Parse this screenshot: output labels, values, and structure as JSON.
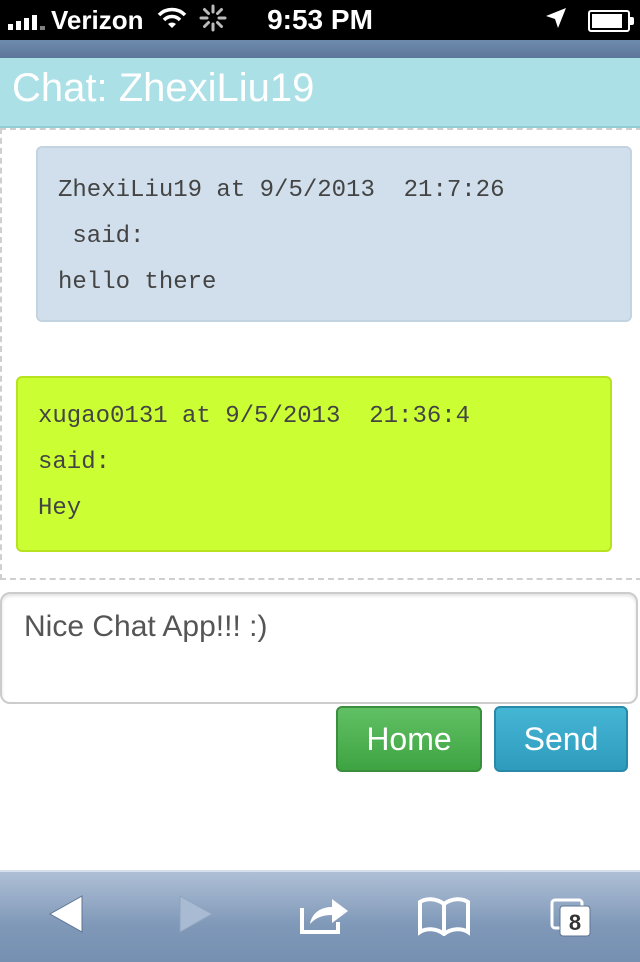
{
  "status_bar": {
    "carrier": "Verizon",
    "time": "9:53 PM"
  },
  "header": {
    "title": "Chat: ZhexiLiu19"
  },
  "messages": [
    {
      "author": "ZhexiLiu19",
      "header": "ZhexiLiu19 at 9/5/2013  21:7:26\n said:",
      "text": "hello there",
      "bg_color": "#d0dfeb"
    },
    {
      "author": "xugao0131",
      "header": "xugao0131 at 9/5/2013  21:36:4\nsaid:",
      "text": "Hey",
      "bg_color": "#ccff33"
    }
  ],
  "input": {
    "value": "Nice Chat App!!! :)"
  },
  "buttons": {
    "home": "Home",
    "send": "Send"
  },
  "toolbar": {
    "tabs_count": "8",
    "icons": [
      "back-icon",
      "forward-icon",
      "share-icon",
      "bookmarks-icon",
      "tabs-icon"
    ]
  }
}
